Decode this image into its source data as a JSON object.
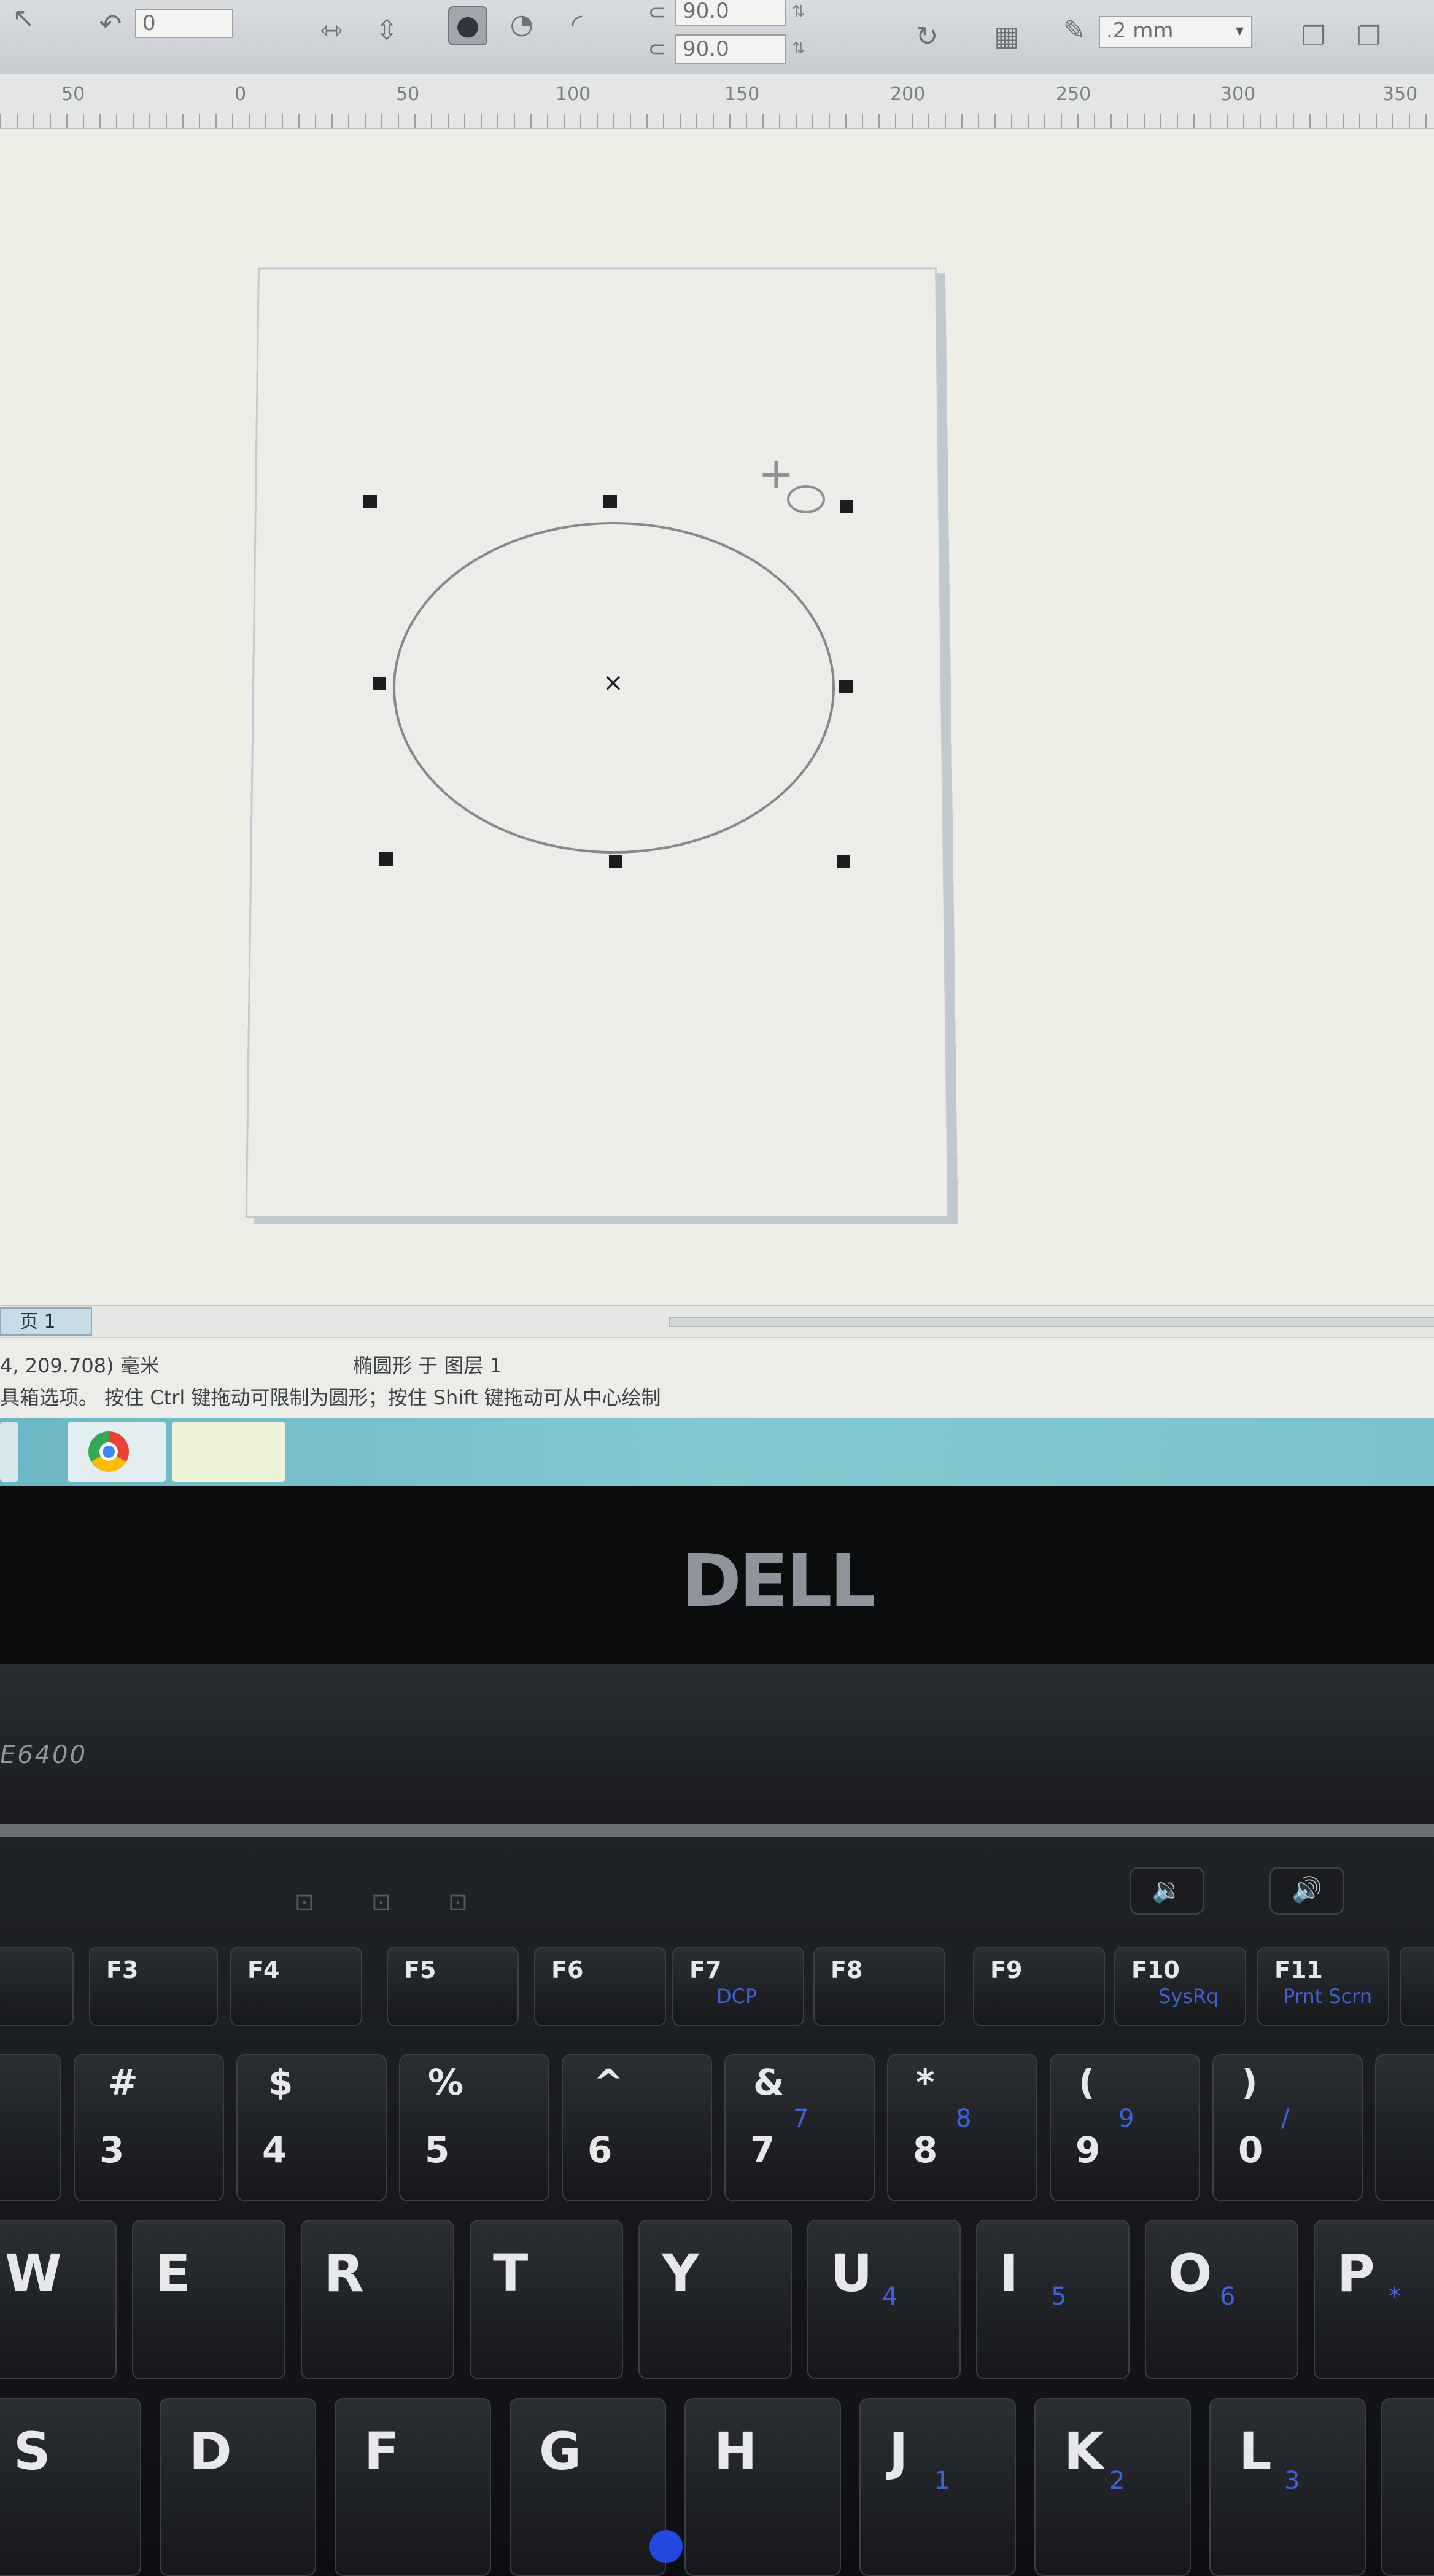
{
  "toolbar": {
    "rotation_value": "0",
    "angle_start": "90.0",
    "angle_end": "90.0",
    "outline_width": ".2 mm"
  },
  "ruler": {
    "labels": [
      "50",
      "0",
      "50",
      "100",
      "150",
      "200",
      "250",
      "300",
      "350"
    ]
  },
  "page_tab": "页 1",
  "status": {
    "line1_left": "4, 209.708)  毫米",
    "line1_center": "椭圆形 于 图层 1",
    "line2": "具箱选项。 按住 Ctrl 键拖动可限制为圆形；按住 Shift 键拖动可从中心绘制"
  },
  "laptop": {
    "brand": "DELL",
    "model": "E6400"
  },
  "keyboard": {
    "fn_keys": [
      {
        "label": "F3",
        "sub": ""
      },
      {
        "label": "F4",
        "sub": ""
      },
      {
        "label": "F5",
        "sub": ""
      },
      {
        "label": "F6",
        "sub": ""
      },
      {
        "label": "F7",
        "sub": "DCP"
      },
      {
        "label": "F8",
        "sub": ""
      },
      {
        "label": "F9",
        "sub": ""
      },
      {
        "label": "F10",
        "sub": "SysRq"
      },
      {
        "label": "F11",
        "sub": "Prnt Scrn"
      }
    ],
    "number_keys": [
      {
        "top": "#",
        "bottom": "3",
        "blue": ""
      },
      {
        "top": "$",
        "bottom": "4",
        "blue": ""
      },
      {
        "top": "%",
        "bottom": "5",
        "blue": ""
      },
      {
        "top": "^",
        "bottom": "6",
        "blue": ""
      },
      {
        "top": "&",
        "bottom": "7",
        "blue": "7"
      },
      {
        "top": "*",
        "bottom": "8",
        "blue": "8"
      },
      {
        "top": "(",
        "bottom": "9",
        "blue": "9"
      },
      {
        "top": ")",
        "bottom": "0",
        "blue": "/"
      }
    ],
    "qwerty_keys": [
      {
        "main": "W",
        "blue": ""
      },
      {
        "main": "E",
        "blue": ""
      },
      {
        "main": "R",
        "blue": ""
      },
      {
        "main": "T",
        "blue": ""
      },
      {
        "main": "Y",
        "blue": ""
      },
      {
        "main": "U",
        "blue": "4"
      },
      {
        "main": "I",
        "blue": "5"
      },
      {
        "main": "O",
        "blue": "6"
      },
      {
        "main": "P",
        "blue": "*"
      }
    ],
    "home_keys": [
      {
        "main": "S",
        "blue": ""
      },
      {
        "main": "D",
        "blue": ""
      },
      {
        "main": "F",
        "blue": ""
      },
      {
        "main": "G",
        "blue": ""
      },
      {
        "main": "H",
        "blue": ""
      },
      {
        "main": "J",
        "blue": "1"
      },
      {
        "main": "K",
        "blue": "2"
      },
      {
        "main": "L",
        "blue": "3"
      }
    ]
  }
}
